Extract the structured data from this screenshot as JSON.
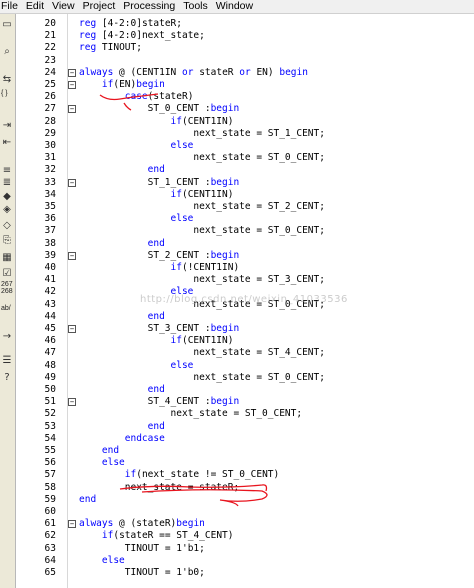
{
  "menubar": {
    "items": [
      "File",
      "Edit",
      "View",
      "Project",
      "Processing",
      "Tools",
      "Window"
    ]
  },
  "toolbar": {
    "tools": [
      {
        "icon": "selection-icon"
      },
      {
        "icon": "zoom-binoculars-icon"
      },
      {
        "icon": "insert-template-icon"
      },
      {
        "icon": "brace-match-icon",
        "text": "{ }"
      },
      {
        "icon": "indent-icon"
      },
      {
        "icon": "unindent-icon"
      },
      {
        "icon": "comment-icon"
      },
      {
        "icon": "uncomment-icon"
      },
      {
        "icon": "bookmark-toggle-icon"
      },
      {
        "icon": "bookmark-next-icon"
      },
      {
        "icon": "bookmark-previous-icon"
      },
      {
        "icon": "attach-file-icon"
      },
      {
        "icon": "create-symbol-icon"
      },
      {
        "icon": "check-icon"
      },
      {
        "icon": "number-format-icon",
        "text": "267\n268"
      },
      {
        "icon": "ab-icon",
        "text": "ab/"
      },
      {
        "icon": "arrow-right-icon"
      },
      {
        "icon": "list-icon"
      },
      {
        "icon": "help-icon"
      }
    ]
  },
  "editor": {
    "watermark": "http://blog.csdn.net/weixin_41033536",
    "lines": [
      {
        "num": "20",
        "fold": "",
        "text": "reg [4-2:0]stateR;"
      },
      {
        "num": "21",
        "fold": "",
        "text": "reg [4-2:0]next_state;"
      },
      {
        "num": "22",
        "fold": "",
        "text": "reg TINOUT;"
      },
      {
        "num": "23",
        "fold": "",
        "text": ""
      },
      {
        "num": "24",
        "fold": "−",
        "text": "always @ (CENT1IN or stateR or EN) begin"
      },
      {
        "num": "25",
        "fold": "−",
        "text": "    if(EN)begin"
      },
      {
        "num": "26",
        "fold": "",
        "text": "        case(stateR)"
      },
      {
        "num": "27",
        "fold": "−",
        "text": "            ST_0_CENT :begin"
      },
      {
        "num": "28",
        "fold": "",
        "text": "                if(CENT1IN)"
      },
      {
        "num": "29",
        "fold": "",
        "text": "                    next_state = ST_1_CENT;"
      },
      {
        "num": "30",
        "fold": "",
        "text": "                else"
      },
      {
        "num": "31",
        "fold": "",
        "text": "                    next_state = ST_0_CENT;"
      },
      {
        "num": "32",
        "fold": "",
        "text": "            end"
      },
      {
        "num": "33",
        "fold": "−",
        "text": "            ST_1_CENT :begin"
      },
      {
        "num": "34",
        "fold": "",
        "text": "                if(CENT1IN)"
      },
      {
        "num": "35",
        "fold": "",
        "text": "                    next_state = ST_2_CENT;"
      },
      {
        "num": "36",
        "fold": "",
        "text": "                else"
      },
      {
        "num": "37",
        "fold": "",
        "text": "                    next_state = ST_0_CENT;"
      },
      {
        "num": "38",
        "fold": "",
        "text": "            end"
      },
      {
        "num": "39",
        "fold": "−",
        "text": "            ST_2_CENT :begin"
      },
      {
        "num": "40",
        "fold": "",
        "text": "                if(!CENT1IN)"
      },
      {
        "num": "41",
        "fold": "",
        "text": "                    next_state = ST_3_CENT;"
      },
      {
        "num": "42",
        "fold": "",
        "text": "                else"
      },
      {
        "num": "43",
        "fold": "",
        "text": "                    next_state = ST_0_CENT;"
      },
      {
        "num": "44",
        "fold": "",
        "text": "            end"
      },
      {
        "num": "45",
        "fold": "−",
        "text": "            ST_3_CENT :begin"
      },
      {
        "num": "46",
        "fold": "",
        "text": "                if(CENT1IN)"
      },
      {
        "num": "47",
        "fold": "",
        "text": "                    next_state = ST_4_CENT;"
      },
      {
        "num": "48",
        "fold": "",
        "text": "                else"
      },
      {
        "num": "49",
        "fold": "",
        "text": "                    next_state = ST_0_CENT;"
      },
      {
        "num": "50",
        "fold": "",
        "text": "            end"
      },
      {
        "num": "51",
        "fold": "−",
        "text": "            ST_4_CENT :begin"
      },
      {
        "num": "52",
        "fold": "",
        "text": "                next_state = ST_0_CENT;"
      },
      {
        "num": "53",
        "fold": "",
        "text": "            end"
      },
      {
        "num": "54",
        "fold": "",
        "text": "        endcase"
      },
      {
        "num": "55",
        "fold": "",
        "text": "    end"
      },
      {
        "num": "56",
        "fold": "",
        "text": "    else"
      },
      {
        "num": "57",
        "fold": "",
        "text": "        if(next_state != ST_0_CENT)"
      },
      {
        "num": "58",
        "fold": "",
        "text": "        next_state = stateR;"
      },
      {
        "num": "59",
        "fold": "",
        "text": "end"
      },
      {
        "num": "60",
        "fold": "",
        "text": ""
      },
      {
        "num": "61",
        "fold": "−",
        "text": "always @ (stateR)begin"
      },
      {
        "num": "62",
        "fold": "",
        "text": "    if(stateR == ST_4_CENT)"
      },
      {
        "num": "63",
        "fold": "",
        "text": "        TINOUT = 1'b1;"
      },
      {
        "num": "64",
        "fold": "",
        "text": "    else"
      },
      {
        "num": "65",
        "fold": "",
        "text": "        TINOUT = 1'b0;"
      }
    ]
  },
  "colors": {
    "keyword": "#0000ff",
    "text": "#000000",
    "annotation": "#e8141e"
  }
}
